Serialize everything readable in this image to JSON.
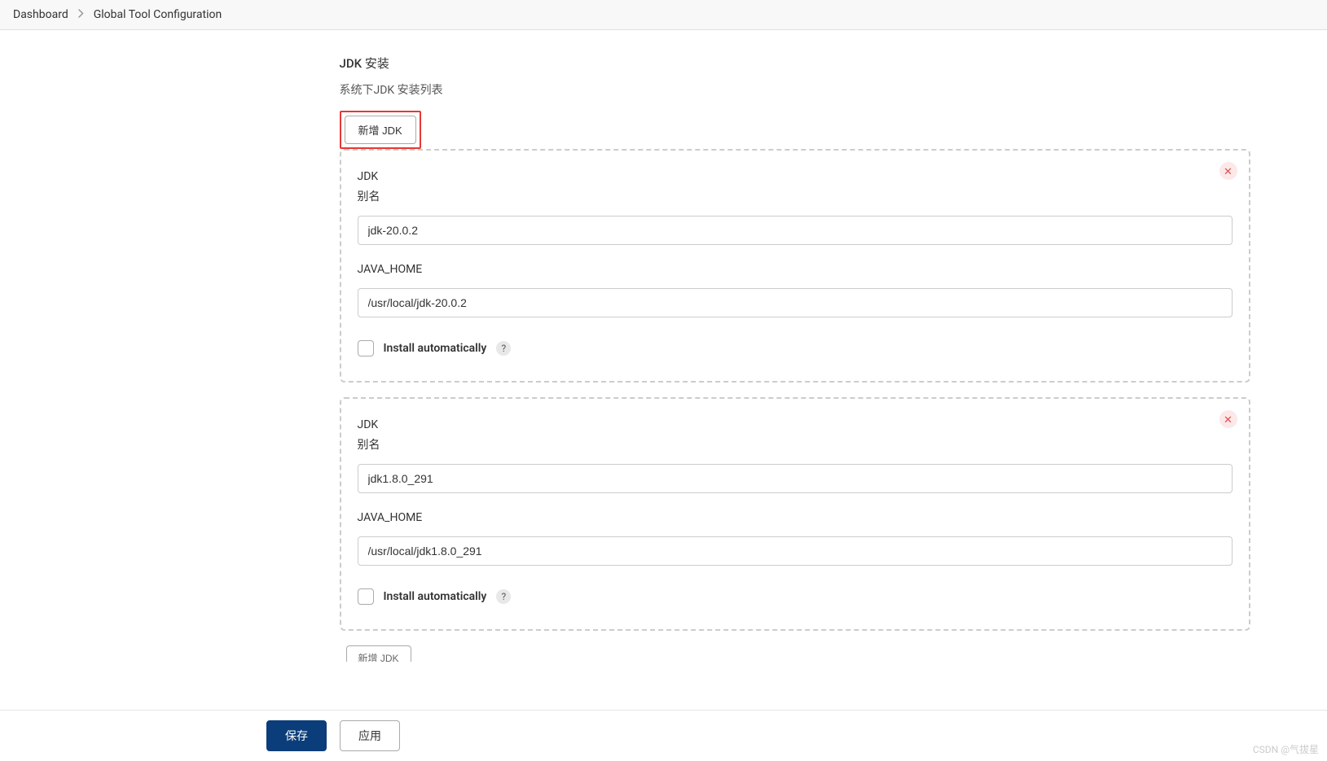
{
  "breadcrumb": {
    "dashboard": "Dashboard",
    "current": "Global Tool Configuration"
  },
  "section": {
    "title": "JDK 安装",
    "subtitle": "系统下JDK 安装列表",
    "addButton": "新增 JDK",
    "addButtonBottom": "新增 JDK"
  },
  "entries": [
    {
      "typeLabel": "JDK",
      "aliasLabel": "别名",
      "aliasValue": "jdk-20.0.2",
      "javaHomeLabel": "JAVA_HOME",
      "javaHomeValue": "/usr/local/jdk-20.0.2",
      "installAutoLabel": "Install automatically"
    },
    {
      "typeLabel": "JDK",
      "aliasLabel": "别名",
      "aliasValue": "jdk1.8.0_291",
      "javaHomeLabel": "JAVA_HOME",
      "javaHomeValue": "/usr/local/jdk1.8.0_291",
      "installAutoLabel": "Install automatically"
    }
  ],
  "footer": {
    "save": "保存",
    "apply": "应用"
  },
  "watermark": "CSDN @气拔星"
}
